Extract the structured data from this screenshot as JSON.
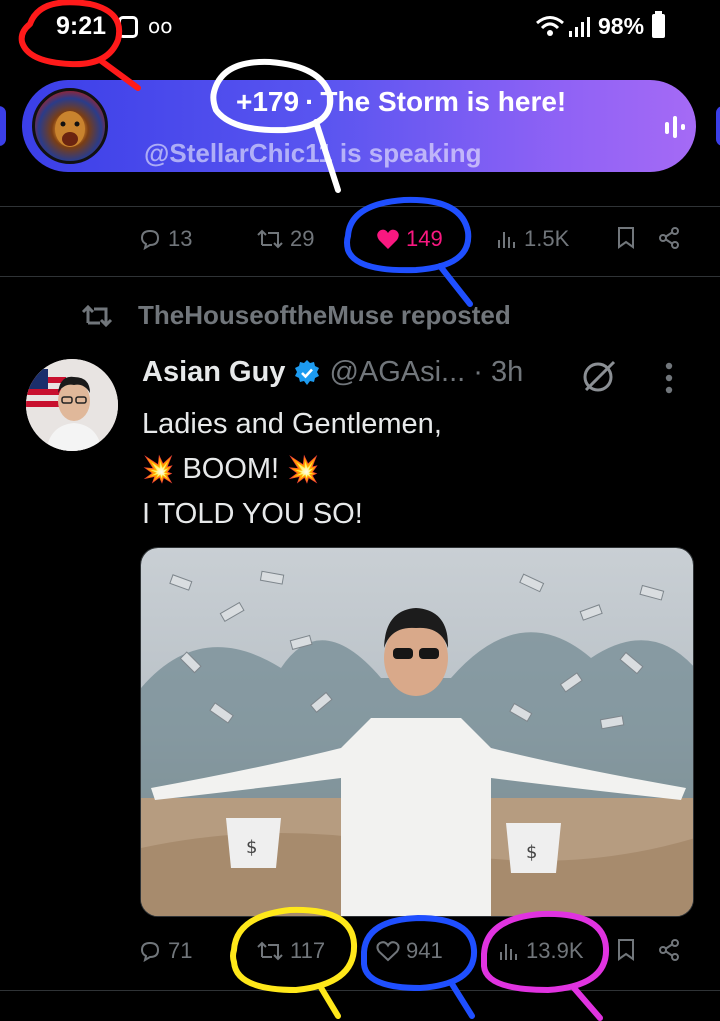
{
  "status_bar": {
    "time": "9:21",
    "voicemail_icon": "oo",
    "battery": "98%"
  },
  "space": {
    "listener_count": "+179",
    "separator": "·",
    "title": "The Storm is here!",
    "speaker": "@StellarChic11 is speaking"
  },
  "prev_tweet_actions": {
    "replies": "13",
    "reposts": "29",
    "likes": "149",
    "views": "1.5K"
  },
  "repost_banner": {
    "text": "TheHouseoftheMuse reposted"
  },
  "tweet": {
    "name": "Asian Guy",
    "handle": "@AGAsi...",
    "time": "· 3h",
    "lines": [
      "Ladies and Gentlemen,",
      "BOOM!",
      "I TOLD YOU SO!"
    ],
    "boom_emoji": "💥",
    "actions": {
      "replies": "71",
      "reposts": "117",
      "likes": "941",
      "views": "13.9K"
    }
  },
  "colors": {
    "background": "#000000",
    "text": "#e7e9ea",
    "muted": "#71767b",
    "like": "#f91880",
    "verified": "#1d9bf0",
    "space_start": "#3b3fe8",
    "space_end": "#a56af5",
    "annotation_red": "#ff1a1a",
    "annotation_white": "#ffffff",
    "annotation_blue": "#1f4fff",
    "annotation_yellow": "#ffe81a",
    "annotation_magenta": "#e033e0"
  }
}
